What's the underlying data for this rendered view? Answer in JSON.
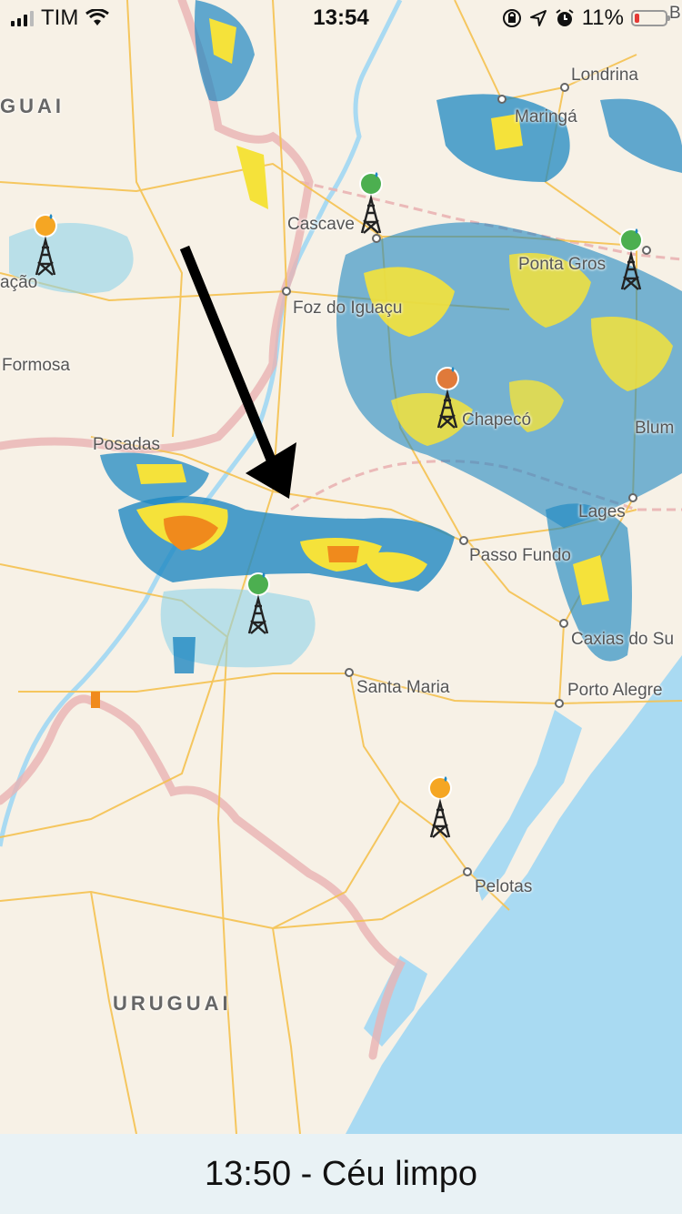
{
  "status_bar": {
    "carrier": "TIM",
    "time": "13:54",
    "battery": "11%",
    "icons": [
      "signal-icon",
      "wifi-icon",
      "orientation-lock-icon",
      "location-icon",
      "alarm-icon",
      "battery-icon"
    ],
    "battery_color": "#e53935"
  },
  "map": {
    "labels": {
      "guai": "GUAI",
      "londrina": "Londrina",
      "maringa": "Maringá",
      "cascavel": "Cascave",
      "ponta_grossa": "Ponta Gros",
      "acao": "ação",
      "foz": "Foz do Iguaçu",
      "formosa": "Formosa",
      "chapeco": "Chapecó",
      "blum": "Blum",
      "posadas": "Posadas",
      "lages": "Lages",
      "passo_fundo": "Passo Fundo",
      "caxias": "Caxias do Su",
      "santa_maria": "Santa Maria",
      "porto_alegre": "Porto Alegre",
      "pelotas": "Pelotas",
      "uruguai": "URUGUAI",
      "corner_b": "B"
    },
    "colors": {
      "land": "#f7f1e6",
      "ocean": "#a9daf2",
      "roads": "#f5c250",
      "border": "#e9b3b3",
      "rain_light": "#8fd3ea",
      "rain_medium": "#1f88c2",
      "rain_heavy": "#f5e23a",
      "rain_severe": "#f08a1c",
      "arrow": "#000000"
    },
    "stations": [
      {
        "name": "radar-station-cascavel",
        "status_color": "#4caf50"
      },
      {
        "name": "radar-station-ponta-grossa",
        "status_color": "#4caf50"
      },
      {
        "name": "radar-station-west",
        "status_color": "#f5a623"
      },
      {
        "name": "radar-station-chapeco",
        "status_color": "#e07a3a"
      },
      {
        "name": "radar-station-southwest",
        "status_color": "#4caf50"
      },
      {
        "name": "radar-station-pelotas",
        "status_color": "#f5a623"
      }
    ]
  },
  "bottom_bar": {
    "text": "13:50 - Céu limpo"
  }
}
